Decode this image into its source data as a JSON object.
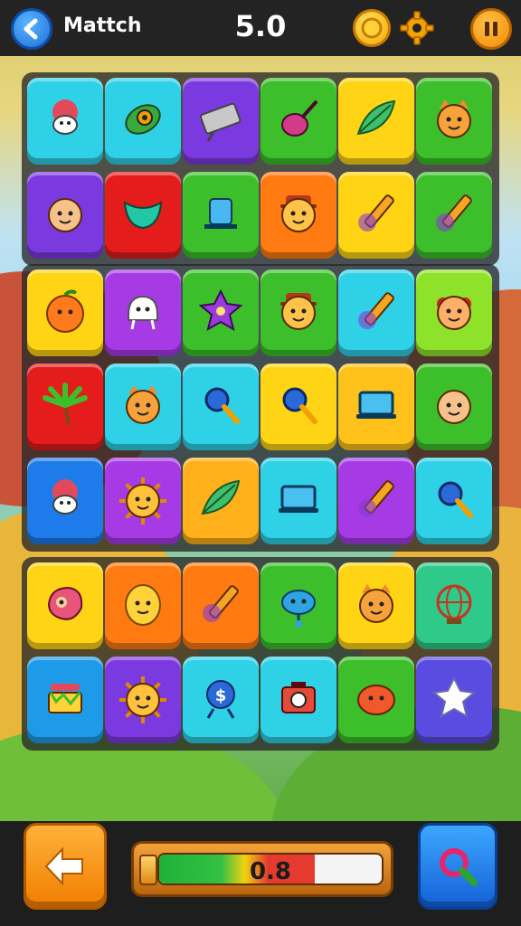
{
  "header": {
    "title": "Mattch",
    "score": "5.0",
    "back_icon": "back-arrow-icon",
    "coin_icon": "coin-icon",
    "settings_icon": "gear-icon",
    "pause_icon": "pause-icon"
  },
  "boards": [
    {
      "rows": [
        [
          {
            "color": "#2fd1e6",
            "icon": "flower-creature-icon"
          },
          {
            "color": "#2fd1e6",
            "icon": "leaf-eye-icon"
          },
          {
            "color": "#7b3ae0",
            "icon": "sign-board-icon"
          },
          {
            "color": "#3cbf2a",
            "icon": "lute-icon"
          },
          {
            "color": "#ffd414",
            "icon": "feather-leaf-icon"
          },
          {
            "color": "#3cbf2a",
            "icon": "cat-face-icon"
          }
        ],
        [
          {
            "color": "#7b3ae0",
            "icon": "kid-face-icon"
          },
          {
            "color": "#e51c1c",
            "icon": "green-mask-icon"
          },
          {
            "color": "#3cbf2a",
            "icon": "jar-icon"
          },
          {
            "color": "#ff7a10",
            "icon": "hat-face-icon"
          },
          {
            "color": "#ffd414",
            "icon": "knife-icon"
          },
          {
            "color": "#3cbf2a",
            "icon": "pencil-icon"
          }
        ]
      ]
    },
    {
      "rows": [
        [
          {
            "color": "#ffd414",
            "icon": "orange-fruit-icon"
          },
          {
            "color": "#a63be6",
            "icon": "ghost-icon"
          },
          {
            "color": "#3cbf2a",
            "icon": "star-blob-icon"
          },
          {
            "color": "#3cbf2a",
            "icon": "hat-face-icon"
          },
          {
            "color": "#2fd1e6",
            "icon": "pencil-icon"
          },
          {
            "color": "#8fe22a",
            "icon": "clown-icon"
          }
        ],
        [
          {
            "color": "#e51c1c",
            "icon": "palm-tree-icon"
          },
          {
            "color": "#2fd1e6",
            "icon": "cat-face-icon"
          },
          {
            "color": "#2fd1e6",
            "icon": "magnifier-icon"
          },
          {
            "color": "#ffd414",
            "icon": "search-icon"
          },
          {
            "color": "#ffc21a",
            "icon": "laptop-icon"
          },
          {
            "color": "#3cbf2a",
            "icon": "hair-face-icon"
          }
        ],
        [
          {
            "color": "#1e7bea",
            "icon": "flower-creature-icon"
          },
          {
            "color": "#a63be6",
            "icon": "sun-face-icon"
          },
          {
            "color": "#ffb01a",
            "icon": "leaf-icon"
          },
          {
            "color": "#2fd1e6",
            "icon": "laptop-icon"
          },
          {
            "color": "#a63be6",
            "icon": "pencil-icon"
          },
          {
            "color": "#2fd1e6",
            "icon": "magnifier-icon"
          }
        ]
      ]
    },
    {
      "rows": [
        [
          {
            "color": "#ffd414",
            "icon": "jelly-face-icon"
          },
          {
            "color": "#ff7a10",
            "icon": "lemon-face-icon"
          },
          {
            "color": "#ff7a10",
            "icon": "marker-icon"
          },
          {
            "color": "#3cbf2a",
            "icon": "blob-creature-icon"
          },
          {
            "color": "#ffd414",
            "icon": "cat-face-icon"
          },
          {
            "color": "#2fc98a",
            "icon": "globe-icon"
          }
        ],
        [
          {
            "color": "#1e9be8",
            "icon": "basket-icon"
          },
          {
            "color": "#7b3ae0",
            "icon": "sun-face-icon"
          },
          {
            "color": "#2fd1e6",
            "icon": "coin-stand-icon"
          },
          {
            "color": "#2fd1e6",
            "icon": "camera-icon"
          },
          {
            "color": "#3cbf2a",
            "icon": "fish-face-icon"
          },
          {
            "color": "#5a4ce0",
            "icon": "star-icon"
          }
        ]
      ]
    }
  ],
  "footer": {
    "undo_icon": "undo-arrow-icon",
    "progress_value": "0.8",
    "progress_fraction": 0.7,
    "search_icon": "search-icon"
  }
}
